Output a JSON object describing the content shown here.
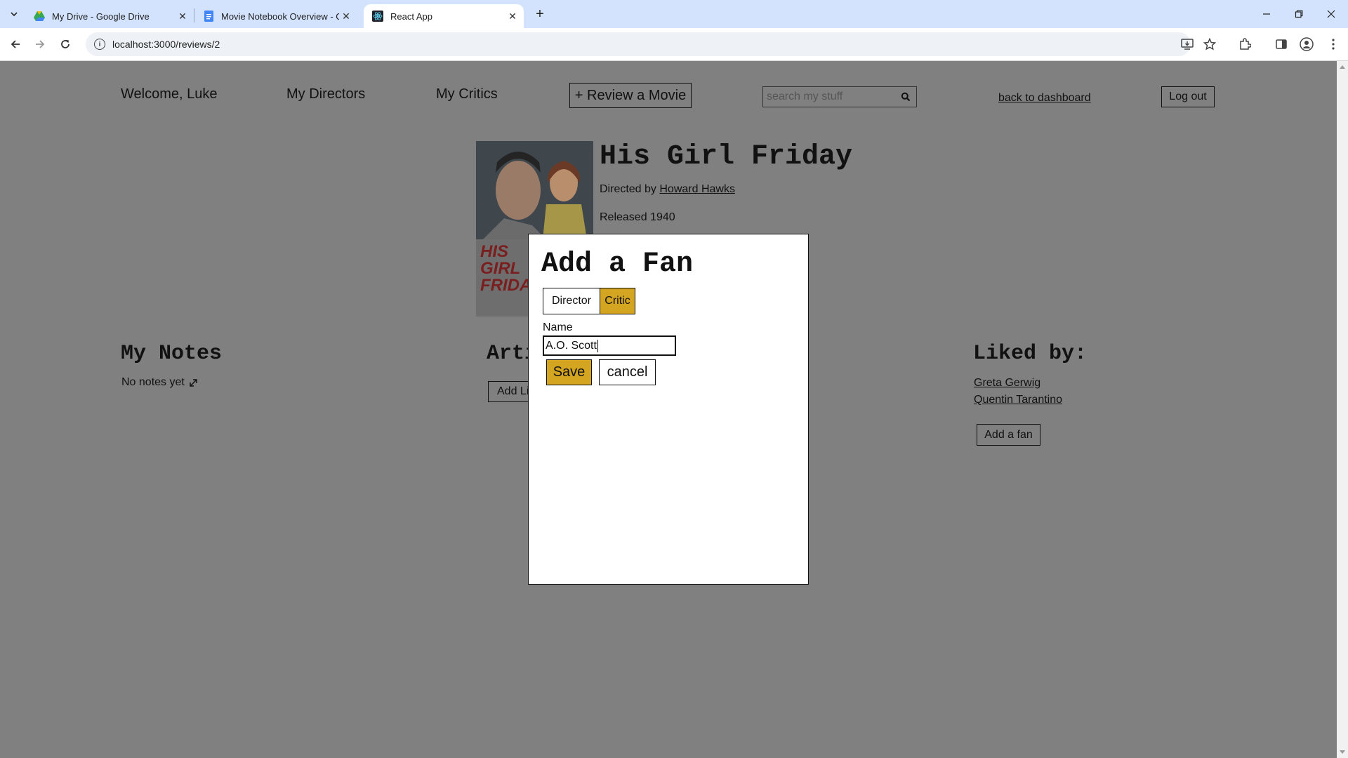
{
  "browser": {
    "tabs": [
      {
        "title": "My Drive - Google Drive",
        "icon": "google-drive-icon"
      },
      {
        "title": "Movie Notebook Overview - Goo",
        "icon": "google-docs-icon"
      },
      {
        "title": "React App",
        "icon": "react-icon"
      }
    ],
    "url": "localhost:3000/reviews/2"
  },
  "header": {
    "welcome": "Welcome, Luke",
    "nav_directors": "My Directors",
    "nav_critics": "My Critics",
    "review_button": "+ Review a Movie",
    "search_placeholder": "search my stuff",
    "back_link": "back to dashboard",
    "logout": "Log out"
  },
  "movie": {
    "title": "His Girl Friday",
    "directed_prefix": "Directed by ",
    "director": "Howard Hawks",
    "released": "Released 1940",
    "poster_text": "HIS GIRL FRIDAY"
  },
  "notes": {
    "heading": "My Notes",
    "empty": "No notes yet"
  },
  "articles": {
    "heading": "Articles",
    "add_button": "Add Link"
  },
  "liked": {
    "heading": "Liked by:",
    "items": [
      "Greta Gerwig",
      "Quentin Tarantino"
    ],
    "add_button": "Add a fan"
  },
  "modal": {
    "title": "Add a Fan",
    "options": [
      "Director",
      "Critic"
    ],
    "selected": "Critic",
    "name_label": "Name",
    "name_value": "A.O. Scott",
    "save": "Save",
    "cancel": "cancel"
  },
  "colors": {
    "accent": "#d4a520",
    "overlay_page": "#808080",
    "tabbar": "#d3e3fd"
  }
}
